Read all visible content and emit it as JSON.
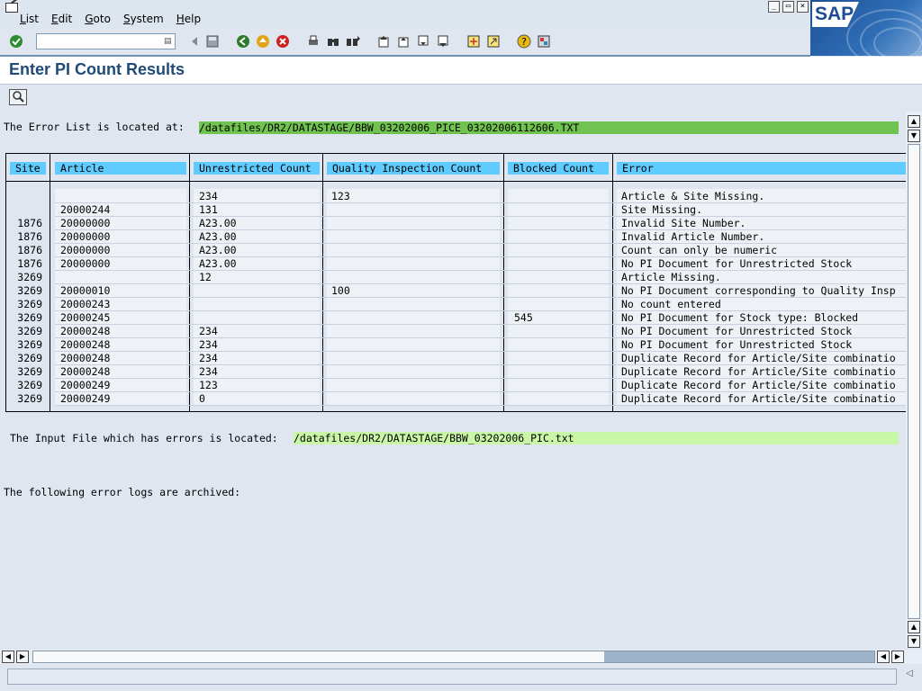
{
  "menu": {
    "items": [
      "List",
      "Edit",
      "Goto",
      "System",
      "Help"
    ]
  },
  "window_controls": [
    "_",
    "▭",
    "×"
  ],
  "brand": {
    "logo": "SAP"
  },
  "page": {
    "title": "Enter PI Count Results"
  },
  "error_list": {
    "label": "The Error List is located at:",
    "path": "/datafiles/DR2/DATASTAGE/BBW_03202006_PICE_03202006112606.TXT"
  },
  "table": {
    "headers": [
      "Site",
      "Article",
      "Unrestricted Count",
      "Quality Inspection Count",
      "Blocked Count",
      "Error"
    ],
    "rows": [
      [
        "",
        "",
        "234",
        "123",
        "",
        "Article & Site Missing."
      ],
      [
        "",
        "20000244",
        "131",
        "",
        "",
        "Site Missing."
      ],
      [
        "1876",
        "20000000",
        "A23.00",
        "",
        "",
        "Invalid Site Number."
      ],
      [
        "1876",
        "20000000",
        "A23.00",
        "",
        "",
        "Invalid Article Number."
      ],
      [
        "1876",
        "20000000",
        "A23.00",
        "",
        "",
        "Count can only be numeric"
      ],
      [
        "1876",
        "20000000",
        "A23.00",
        "",
        "",
        "No PI Document for Unrestricted Stock"
      ],
      [
        "3269",
        "",
        "12",
        "",
        "",
        "Article Missing."
      ],
      [
        "3269",
        "20000010",
        "",
        "100",
        "",
        "No PI Document corresponding to Quality Insp"
      ],
      [
        "3269",
        "20000243",
        "",
        "",
        "",
        "No count entered"
      ],
      [
        "3269",
        "20000245",
        "",
        "",
        "545",
        "No PI Document for Stock type: Blocked"
      ],
      [
        "3269",
        "20000248",
        "234",
        "",
        "",
        "No PI Document for Unrestricted Stock"
      ],
      [
        "3269",
        "20000248",
        "234",
        "",
        "",
        "No PI Document for Unrestricted Stock"
      ],
      [
        "3269",
        "20000248",
        "234",
        "",
        "",
        "Duplicate Record for Article/Site combinatio"
      ],
      [
        "3269",
        "20000248",
        "234",
        "",
        "",
        "Duplicate Record for Article/Site combinatio"
      ],
      [
        "3269",
        "20000249",
        "123",
        "",
        "",
        "Duplicate Record for Article/Site combinatio"
      ],
      [
        "3269",
        "20000249",
        "0",
        "",
        "",
        "Duplicate Record for Article/Site combinatio"
      ]
    ]
  },
  "input_file": {
    "label": "The Input File which has errors is located:",
    "path": "/datafiles/DR2/DATASTAGE/BBW_03202006_PIC.txt"
  },
  "archive": {
    "label": "The following error logs are archived:"
  },
  "colors": {
    "header_blue": "#5fcbff",
    "path_green": "#71c34f",
    "path_light_green": "#c9f7a7",
    "title_blue": "#1f4b78"
  }
}
